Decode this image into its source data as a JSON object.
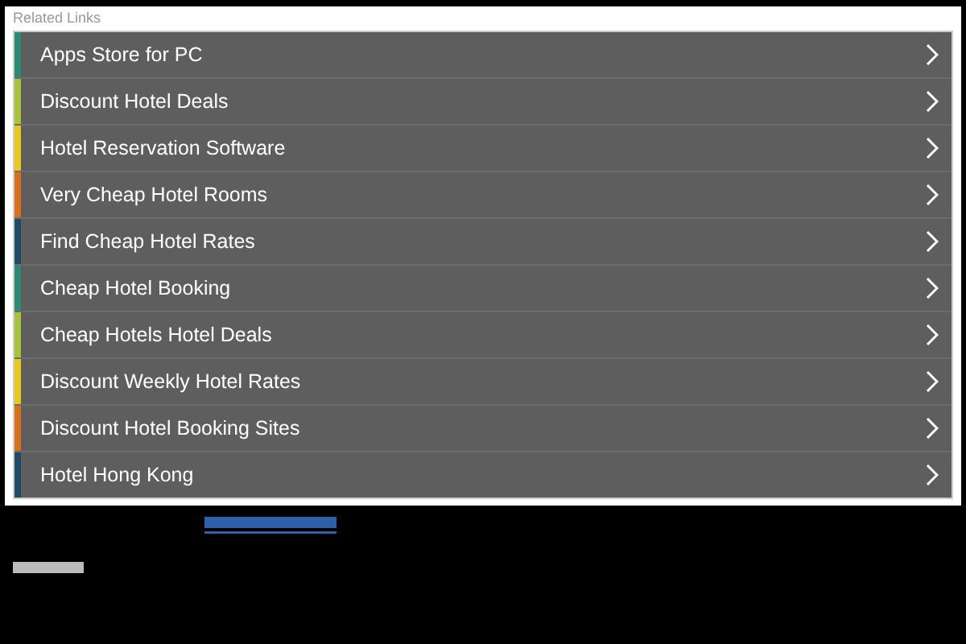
{
  "section_title": "Related Links",
  "links": [
    {
      "label": "Apps Store for PC",
      "color": "#2a8a76"
    },
    {
      "label": "Discount Hotel Deals",
      "color": "#a8c23a"
    },
    {
      "label": "Hotel Reservation Software",
      "color": "#e8c81a"
    },
    {
      "label": "Very Cheap Hotel Rooms",
      "color": "#d8701c"
    },
    {
      "label": "Find Cheap Hotel Rates",
      "color": "#1e4a66"
    },
    {
      "label": "Cheap Hotel Booking",
      "color": "#2a8a76"
    },
    {
      "label": "Cheap Hotels Hotel Deals",
      "color": "#a8c23a"
    },
    {
      "label": "Discount Weekly Hotel Rates",
      "color": "#e8c81a"
    },
    {
      "label": "Discount Hotel Booking Sites",
      "color": "#d8701c"
    },
    {
      "label": "Hotel Hong Kong",
      "color": "#1e4a66"
    }
  ]
}
